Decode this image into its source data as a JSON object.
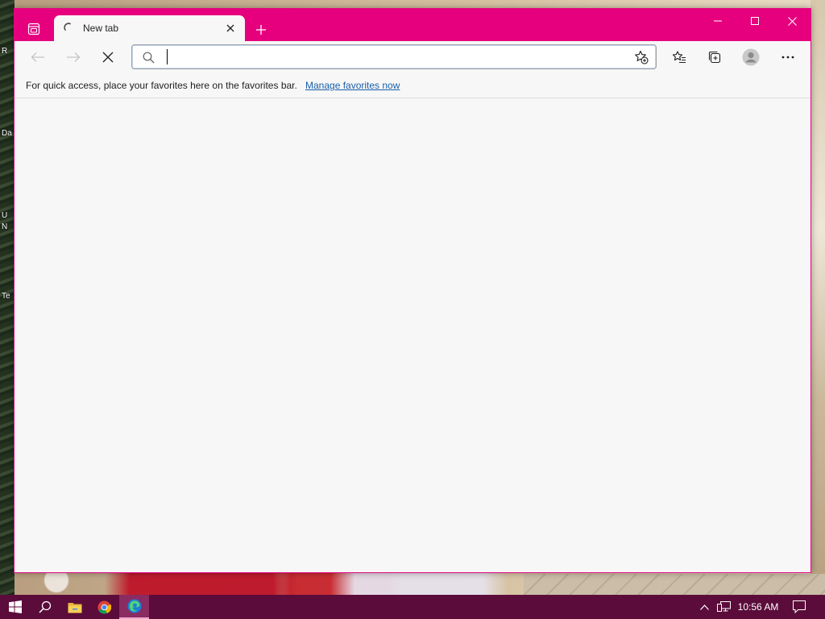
{
  "colors": {
    "accent": "#e6007e",
    "taskbar": "#5b0c3a",
    "link": "#1a5fa8",
    "page_background": "#f7f7f7"
  },
  "desktop": {
    "icon_label_fragments": [
      "R",
      "Da",
      "U",
      "N",
      "Te"
    ]
  },
  "browser": {
    "tab": {
      "title": "New tab",
      "favicon": "loading-spinner-icon",
      "close_icon": "close-icon"
    },
    "new_tab_icon": "plus-icon",
    "window_controls": [
      "minimize-icon",
      "maximize-icon",
      "close-icon"
    ],
    "toolbar": {
      "back_icon": "arrow-left-icon",
      "forward_icon": "arrow-right-icon",
      "stop_icon": "stop-loading-icon",
      "address": {
        "value": "",
        "placeholder": "",
        "search_icon": "search-icon",
        "add_favorite_icon": "star-add-icon"
      },
      "favorites_icon": "favorites-list-icon",
      "collections_icon": "collections-icon",
      "profile_icon": "avatar-icon",
      "more_icon": "more-dots-icon"
    },
    "favorites_bar": {
      "message": "For quick access, place your favorites here on the favorites bar.",
      "link": "Manage favorites now"
    }
  },
  "taskbar": {
    "pinned": [
      "windows-start-icon",
      "search-icon",
      "file-explorer-icon",
      "chrome-icon",
      "edge-icon"
    ],
    "active": "edge-icon",
    "tray": [
      "chevron-up-icon",
      "network-icon",
      "notification-icon"
    ],
    "clock": "10:56 AM"
  }
}
